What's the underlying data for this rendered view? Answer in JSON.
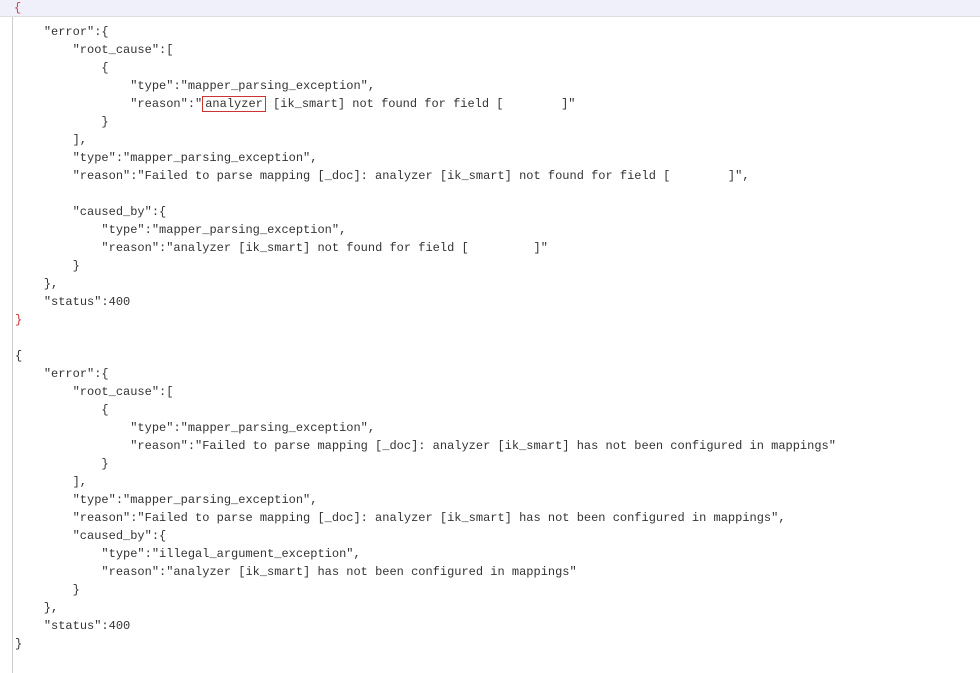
{
  "topbar_text": "{",
  "block1": {
    "k_error": "\"error\"",
    "k_root_cause": "\"root_cause\"",
    "k_type": "\"type\"",
    "v_type_mpe": "\"mapper_parsing_exception\"",
    "k_reason": "\"reason\"",
    "highlighted_word": "analyzer",
    "v_reason_rc_suffix": " [ik_smart] not found for field [        ]\"",
    "v_reason_outer": "\"Failed to parse mapping [_doc]: analyzer [ik_smart] not found for field [        ]\"",
    "k_caused_by": "\"caused_by\"",
    "v_reason_caused": "\"analyzer [ik_smart] not found for field [         ]\"",
    "k_status": "\"status\"",
    "v_status": "400"
  },
  "block2": {
    "k_error": "\"error\"",
    "k_root_cause": "\"root_cause\"",
    "k_type": "\"type\"",
    "v_type_mpe": "\"mapper_parsing_exception\"",
    "k_reason": "\"reason\"",
    "v_reason_rc": "\"Failed to parse mapping [_doc]: analyzer [ik_smart] has not been configured in mappings\"",
    "v_reason_outer": "\"Failed to parse mapping [_doc]: analyzer [ik_smart] has not been configured in mappings\"",
    "k_caused_by": "\"caused_by\"",
    "v_type_iae": "\"illegal_argument_exception\"",
    "v_reason_caused": "\"analyzer [ik_smart] has not been configured in mappings\"",
    "k_status": "\"status\"",
    "v_status": "400"
  }
}
